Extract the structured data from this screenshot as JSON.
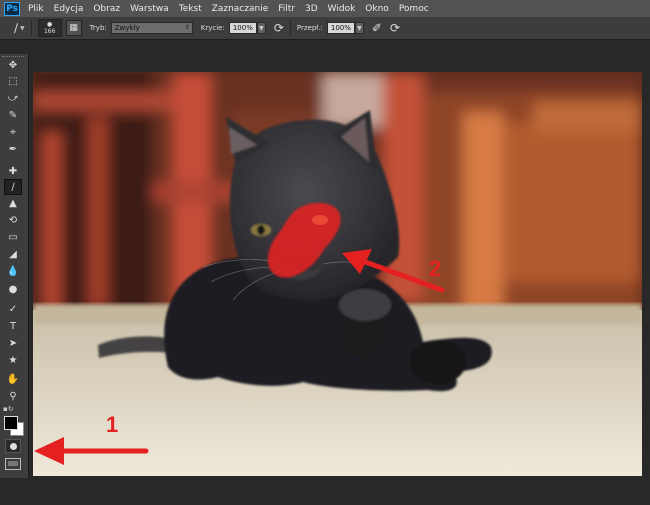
{
  "app": {
    "logo": "Ps"
  },
  "menu": [
    "Plik",
    "Edycja",
    "Obraz",
    "Warstwa",
    "Tekst",
    "Zaznaczanie",
    "Filtr",
    "3D",
    "Widok",
    "Okno",
    "Pomoc"
  ],
  "options": {
    "brush_size": "166",
    "mode_label": "Tryb:",
    "mode_value": "Zwykły",
    "opacity_label": "Krycie:",
    "opacity_value": "100%",
    "flow_label": "Przepł.:",
    "flow_value": "100%"
  },
  "tools": [
    "move-tool",
    "rectangular-marquee-tool",
    "lasso-tool",
    "quick-selection-tool",
    "crop-tool",
    "eyedropper-tool",
    "spot-healing-brush-tool",
    "brush-tool",
    "clone-stamp-tool",
    "history-brush-tool",
    "eraser-tool",
    "paint-bucket-tool",
    "blur-tool",
    "dodge-tool",
    "pen-tool",
    "type-tool",
    "path-selection-tool",
    "custom-shape-tool",
    "hand-tool",
    "zoom-tool",
    "default-colors",
    "color-swatches",
    "quick-mask-mode",
    "screen-mode"
  ],
  "annotations": {
    "arrow1_label": "1",
    "arrow2_label": "2"
  },
  "colors": {
    "arrow": "#e52020",
    "mask_overlay": "#e42020",
    "menubar": "#535353"
  }
}
